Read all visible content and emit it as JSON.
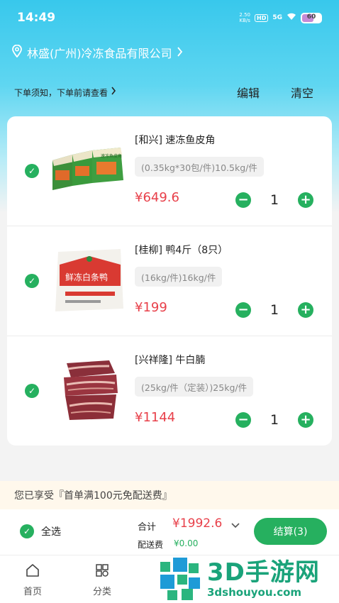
{
  "status": {
    "time": "14:49",
    "speed": "2.50",
    "speed_unit": "KB/s",
    "hd": "HD",
    "signal": "5G",
    "battery": "60"
  },
  "store": {
    "name": "林盛(广州)冷冻食品有限公司"
  },
  "notice": {
    "text": "下单须知，下单前请查看",
    "edit_label": "编辑",
    "clear_label": "清空"
  },
  "cart": {
    "items": [
      {
        "name": "[和兴] 速冻鱼皮角",
        "spec": "(0.35kg*30包/件)10.5kg/件",
        "price": "¥649.6",
        "qty": "1",
        "image": "fish-skin-dumpling-boxes"
      },
      {
        "name": "[桂柳] 鸭4斤（8只）",
        "spec": "(16kg/件)16kg/件",
        "price": "¥199",
        "qty": "1",
        "image": "duck-bag"
      },
      {
        "name": "[兴祥隆] 牛白腩",
        "spec": "(25kg/件（定装）)25kg/件",
        "price": "¥1144",
        "qty": "1",
        "image": "beef-brisket"
      }
    ]
  },
  "promo": {
    "text": "您已享受『首单满100元免配送费』"
  },
  "checkout": {
    "select_all_label": "全选",
    "total_label": "合计",
    "total_value": "¥1992.6",
    "fee_label": "配送费",
    "fee_value": "¥0.00",
    "button_label": "结算(3)"
  },
  "tabbar": {
    "tabs": [
      {
        "label": "首页"
      },
      {
        "label": "分类"
      }
    ]
  },
  "watermark": {
    "title": "3D手游网",
    "url": "3dshouyou.com"
  },
  "colors": {
    "accent": "#26b05f",
    "price": "#e8404a",
    "header": "#38c8ec"
  }
}
